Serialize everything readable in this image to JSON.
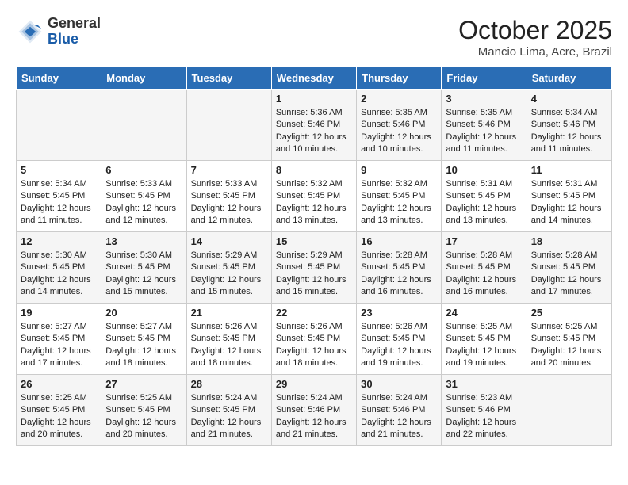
{
  "header": {
    "logo_general": "General",
    "logo_blue": "Blue",
    "month": "October 2025",
    "location": "Mancio Lima, Acre, Brazil"
  },
  "weekdays": [
    "Sunday",
    "Monday",
    "Tuesday",
    "Wednesday",
    "Thursday",
    "Friday",
    "Saturday"
  ],
  "weeks": [
    [
      {
        "day": "",
        "text": ""
      },
      {
        "day": "",
        "text": ""
      },
      {
        "day": "",
        "text": ""
      },
      {
        "day": "1",
        "text": "Sunrise: 5:36 AM\nSunset: 5:46 PM\nDaylight: 12 hours\nand 10 minutes."
      },
      {
        "day": "2",
        "text": "Sunrise: 5:35 AM\nSunset: 5:46 PM\nDaylight: 12 hours\nand 10 minutes."
      },
      {
        "day": "3",
        "text": "Sunrise: 5:35 AM\nSunset: 5:46 PM\nDaylight: 12 hours\nand 11 minutes."
      },
      {
        "day": "4",
        "text": "Sunrise: 5:34 AM\nSunset: 5:46 PM\nDaylight: 12 hours\nand 11 minutes."
      }
    ],
    [
      {
        "day": "5",
        "text": "Sunrise: 5:34 AM\nSunset: 5:45 PM\nDaylight: 12 hours\nand 11 minutes."
      },
      {
        "day": "6",
        "text": "Sunrise: 5:33 AM\nSunset: 5:45 PM\nDaylight: 12 hours\nand 12 minutes."
      },
      {
        "day": "7",
        "text": "Sunrise: 5:33 AM\nSunset: 5:45 PM\nDaylight: 12 hours\nand 12 minutes."
      },
      {
        "day": "8",
        "text": "Sunrise: 5:32 AM\nSunset: 5:45 PM\nDaylight: 12 hours\nand 13 minutes."
      },
      {
        "day": "9",
        "text": "Sunrise: 5:32 AM\nSunset: 5:45 PM\nDaylight: 12 hours\nand 13 minutes."
      },
      {
        "day": "10",
        "text": "Sunrise: 5:31 AM\nSunset: 5:45 PM\nDaylight: 12 hours\nand 13 minutes."
      },
      {
        "day": "11",
        "text": "Sunrise: 5:31 AM\nSunset: 5:45 PM\nDaylight: 12 hours\nand 14 minutes."
      }
    ],
    [
      {
        "day": "12",
        "text": "Sunrise: 5:30 AM\nSunset: 5:45 PM\nDaylight: 12 hours\nand 14 minutes."
      },
      {
        "day": "13",
        "text": "Sunrise: 5:30 AM\nSunset: 5:45 PM\nDaylight: 12 hours\nand 15 minutes."
      },
      {
        "day": "14",
        "text": "Sunrise: 5:29 AM\nSunset: 5:45 PM\nDaylight: 12 hours\nand 15 minutes."
      },
      {
        "day": "15",
        "text": "Sunrise: 5:29 AM\nSunset: 5:45 PM\nDaylight: 12 hours\nand 15 minutes."
      },
      {
        "day": "16",
        "text": "Sunrise: 5:28 AM\nSunset: 5:45 PM\nDaylight: 12 hours\nand 16 minutes."
      },
      {
        "day": "17",
        "text": "Sunrise: 5:28 AM\nSunset: 5:45 PM\nDaylight: 12 hours\nand 16 minutes."
      },
      {
        "day": "18",
        "text": "Sunrise: 5:28 AM\nSunset: 5:45 PM\nDaylight: 12 hours\nand 17 minutes."
      }
    ],
    [
      {
        "day": "19",
        "text": "Sunrise: 5:27 AM\nSunset: 5:45 PM\nDaylight: 12 hours\nand 17 minutes."
      },
      {
        "day": "20",
        "text": "Sunrise: 5:27 AM\nSunset: 5:45 PM\nDaylight: 12 hours\nand 18 minutes."
      },
      {
        "day": "21",
        "text": "Sunrise: 5:26 AM\nSunset: 5:45 PM\nDaylight: 12 hours\nand 18 minutes."
      },
      {
        "day": "22",
        "text": "Sunrise: 5:26 AM\nSunset: 5:45 PM\nDaylight: 12 hours\nand 18 minutes."
      },
      {
        "day": "23",
        "text": "Sunrise: 5:26 AM\nSunset: 5:45 PM\nDaylight: 12 hours\nand 19 minutes."
      },
      {
        "day": "24",
        "text": "Sunrise: 5:25 AM\nSunset: 5:45 PM\nDaylight: 12 hours\nand 19 minutes."
      },
      {
        "day": "25",
        "text": "Sunrise: 5:25 AM\nSunset: 5:45 PM\nDaylight: 12 hours\nand 20 minutes."
      }
    ],
    [
      {
        "day": "26",
        "text": "Sunrise: 5:25 AM\nSunset: 5:45 PM\nDaylight: 12 hours\nand 20 minutes."
      },
      {
        "day": "27",
        "text": "Sunrise: 5:25 AM\nSunset: 5:45 PM\nDaylight: 12 hours\nand 20 minutes."
      },
      {
        "day": "28",
        "text": "Sunrise: 5:24 AM\nSunset: 5:45 PM\nDaylight: 12 hours\nand 21 minutes."
      },
      {
        "day": "29",
        "text": "Sunrise: 5:24 AM\nSunset: 5:46 PM\nDaylight: 12 hours\nand 21 minutes."
      },
      {
        "day": "30",
        "text": "Sunrise: 5:24 AM\nSunset: 5:46 PM\nDaylight: 12 hours\nand 21 minutes."
      },
      {
        "day": "31",
        "text": "Sunrise: 5:23 AM\nSunset: 5:46 PM\nDaylight: 12 hours\nand 22 minutes."
      },
      {
        "day": "",
        "text": ""
      }
    ]
  ]
}
